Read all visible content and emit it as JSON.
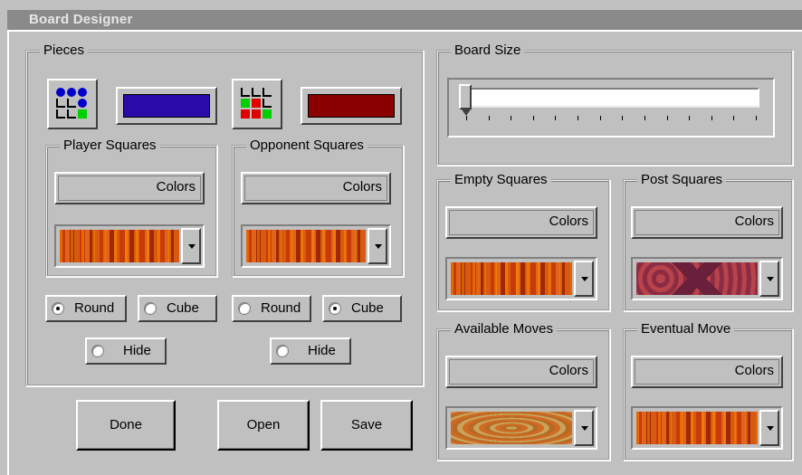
{
  "window": {
    "title": "Board Designer"
  },
  "pieces": {
    "legend": "Pieces",
    "player_color": "#2a0aa8",
    "opponent_color": "#8a0000",
    "player_squares": {
      "legend": "Player Squares",
      "colors_label": "Colors",
      "pattern": "orange-pattern"
    },
    "opponent_squares": {
      "legend": "Opponent Squares",
      "colors_label": "Colors",
      "pattern": "orange-pattern"
    },
    "player_shape": {
      "round_label": "Round",
      "cube_label": "Cube",
      "selected": "Round"
    },
    "opponent_shape": {
      "round_label": "Round",
      "cube_label": "Cube",
      "selected": "Cube"
    },
    "player_hide_label": "Hide",
    "opponent_hide_label": "Hide"
  },
  "board_size": {
    "legend": "Board Size",
    "slider_value": 0,
    "tick_count": 14
  },
  "empty_squares": {
    "legend": "Empty Squares",
    "colors_label": "Colors",
    "pattern": "orange-pattern"
  },
  "post_squares": {
    "legend": "Post Squares",
    "colors_label": "Colors",
    "pattern": "purple-pattern"
  },
  "available_moves": {
    "legend": "Available Moves",
    "colors_label": "Colors",
    "pattern": "beige-pattern"
  },
  "eventual_move": {
    "legend": "Eventual Move",
    "colors_label": "Colors",
    "pattern": "orange-pattern"
  },
  "buttons": {
    "done": "Done",
    "open": "Open",
    "save": "Save"
  }
}
